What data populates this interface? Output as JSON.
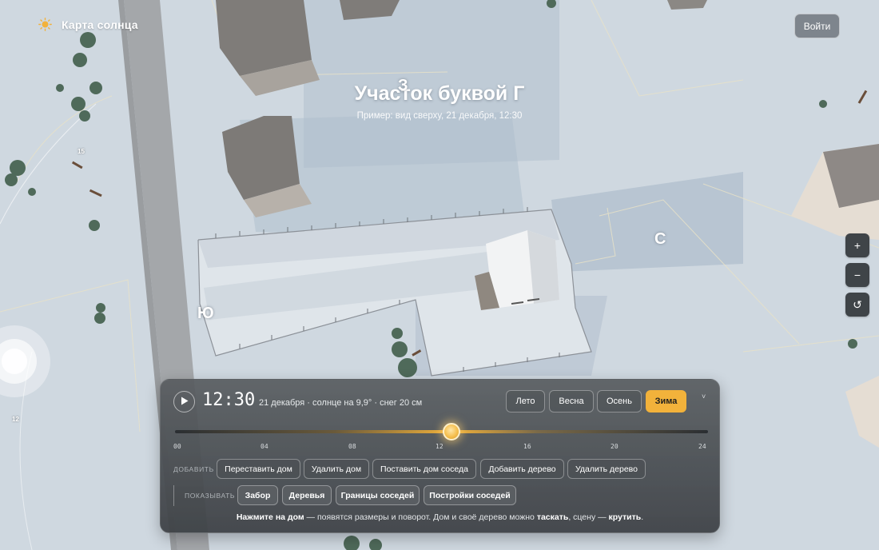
{
  "header": {
    "brand": "Карта солнца",
    "login_label": "Войти"
  },
  "map": {
    "title": "Участок буквой Г",
    "subtitle": "Пример: вид сверху, 21 декабря, 12:30",
    "directions": {
      "north": "С",
      "south": "Ю",
      "west": "З"
    },
    "tile_numbers": [
      "15",
      "12"
    ]
  },
  "zoom_controls": {
    "zoom_in": "+",
    "zoom_out": "−",
    "reset": "↺"
  },
  "panel": {
    "time": "12:30",
    "info": "21 декабря · солнце на 9,9° · снег 20 см",
    "seasons": [
      "Лето",
      "Весна",
      "Осень",
      "Зима"
    ],
    "active_season": "Зима",
    "collapse": "˅",
    "slider": {
      "ticks": [
        "00",
        "04",
        "08",
        "12",
        "16",
        "20",
        "24"
      ],
      "value_hours": 12.5,
      "max_hours": 24
    },
    "add_label": "ДОБАВИТЬ",
    "add_actions": [
      "Переставить дом",
      "Удалить дом",
      "Поставить дом соседа",
      "Добавить дерево",
      "Удалить дерево"
    ],
    "show_label": "ПОКАЗЫВАТЬ",
    "show_toggles": [
      "Забор",
      "Деревья",
      "Границы соседей",
      "Постройки соседей"
    ],
    "hint": {
      "bold1": "Нажмите на дом",
      "text1": " — появятся размеры и поворот. Дом и своё дерево можно ",
      "bold2": "таскать",
      "text2": ", сцену — ",
      "bold3": "крутить",
      "text3": "."
    }
  },
  "colors": {
    "accent": "#f2b23b",
    "snow": "#d6dde4",
    "shadow": "#a6b5c4",
    "panel": "#4a4e52"
  }
}
